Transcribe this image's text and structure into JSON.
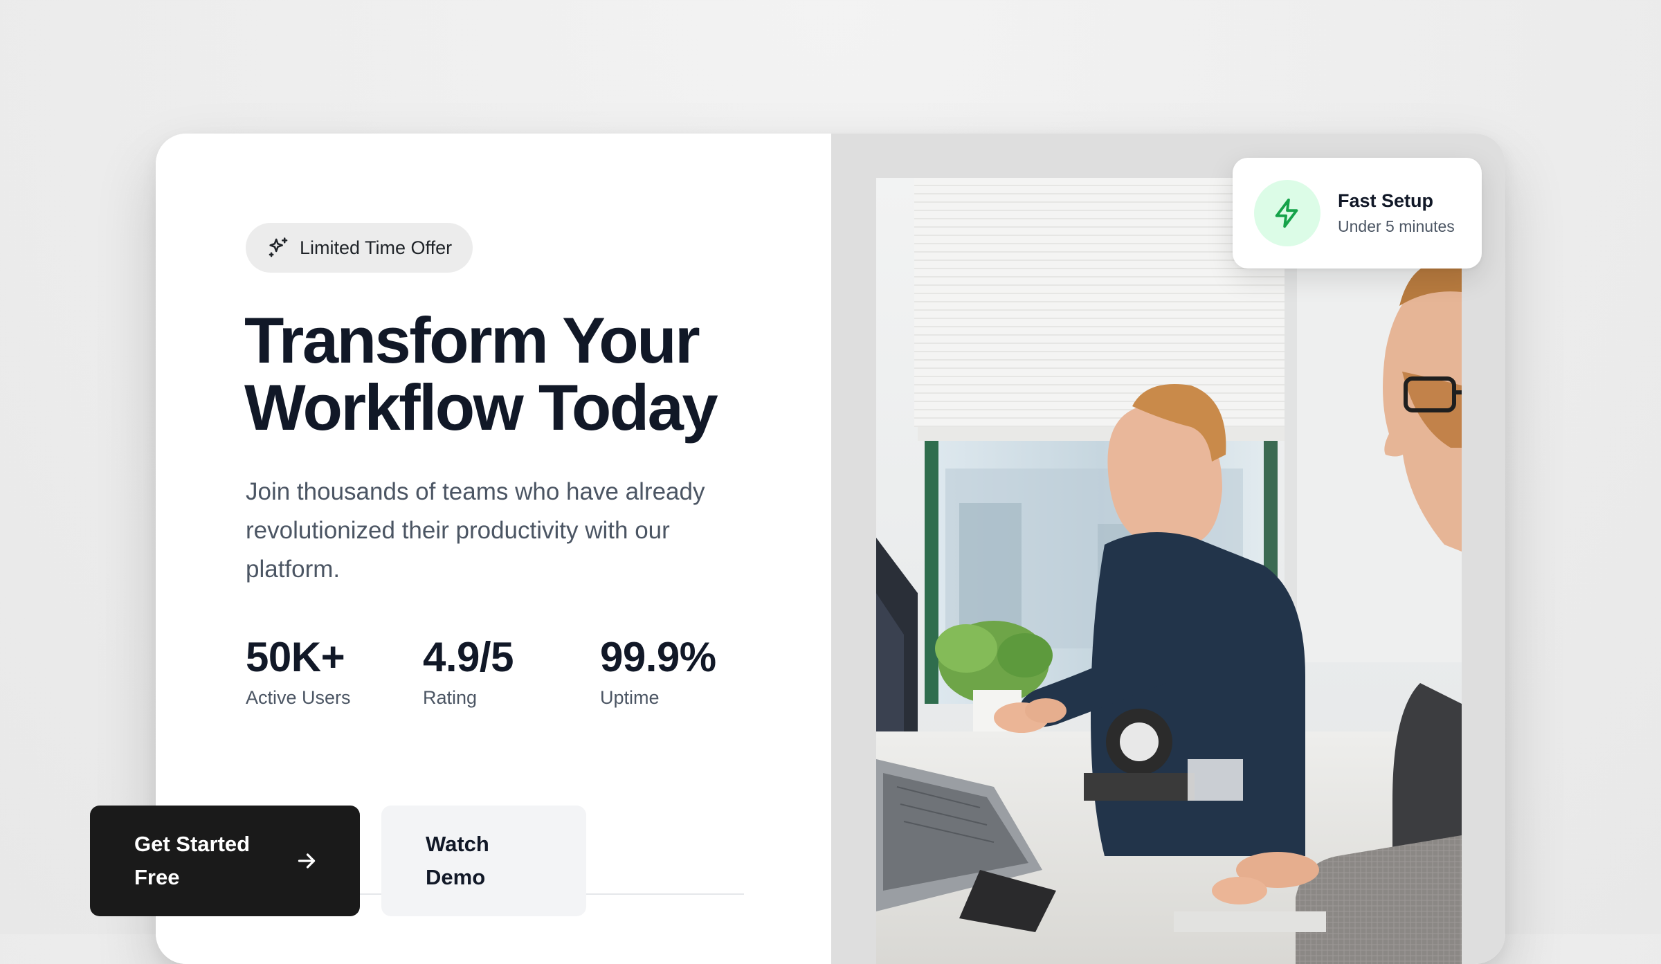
{
  "badge": {
    "icon": "sparkles-icon",
    "label": "Limited Time Offer"
  },
  "hero": {
    "headline_line1": "Transform Your",
    "headline_line2": "Workflow Today",
    "subtitle": "Join thousands of teams who have already revolutionized their productivity with our platform."
  },
  "stats": [
    {
      "value": "50K+",
      "label": "Active Users"
    },
    {
      "value": "4.9/5",
      "label": "Rating"
    },
    {
      "value": "99.9%",
      "label": "Uptime"
    }
  ],
  "actions": {
    "primary_label": "Get Started Free",
    "primary_icon": "arrow-right-icon",
    "secondary_label": "Watch Demo"
  },
  "feature_card": {
    "icon": "lightning-bolt-icon",
    "title": "Fast Setup",
    "subtitle": "Under 5 minutes"
  },
  "colors": {
    "primary_button": "#1a1a1a",
    "secondary_button": "#f3f4f6",
    "heading": "#111827",
    "body_text": "#4b5563",
    "accent_green": "#16a34a",
    "accent_green_bg": "#dcfce7"
  }
}
